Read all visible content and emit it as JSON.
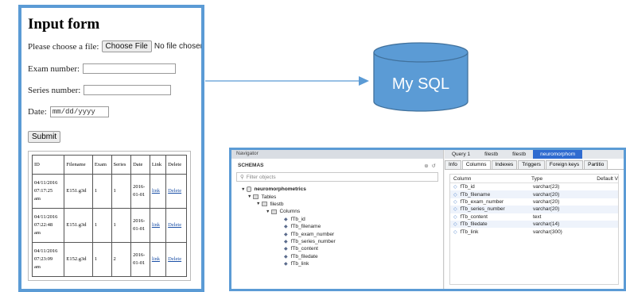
{
  "form": {
    "title": "Input form",
    "file_label": "Please choose a file:",
    "choose_file_button": "Choose File",
    "no_file_text": "No file chosen",
    "exam_label": "Exam number:",
    "series_label": "Series number:",
    "date_label": "Date:",
    "date_placeholder": "mm/dd/yyyy",
    "submit_button": "Submit",
    "table": {
      "headers": [
        "ID",
        "Filename",
        "Exam",
        "Series",
        "Date",
        "Link",
        "Delete"
      ],
      "rows": [
        {
          "id_date": "04/11/2016",
          "id_time": "07:17:25",
          "id_suffix": "am",
          "filename": "E151.g3d",
          "exam": "1",
          "series": "1",
          "date_year": "2016-",
          "date_md": "01-01",
          "link": "link",
          "delete": "Delete"
        },
        {
          "id_date": "04/11/2016",
          "id_time": "07:22:48",
          "id_suffix": "am",
          "filename": "E151.g3d",
          "exam": "1",
          "series": "1",
          "date_year": "2016-",
          "date_md": "01-01",
          "link": "link",
          "delete": "Delete"
        },
        {
          "id_date": "04/11/2016",
          "id_time": "07:23:09",
          "id_suffix": "am",
          "filename": "E152.g3d",
          "exam": "1",
          "series": "2",
          "date_year": "2016-",
          "date_md": "01-01",
          "link": "link",
          "delete": "Delete"
        }
      ]
    }
  },
  "database": {
    "label": "My SQL",
    "fill": "#5b9bd5",
    "stroke": "#41719c"
  },
  "arrow_color": "#5b9bd5",
  "workbench": {
    "navigator": "Navigator",
    "schemas": "SCHEMAS",
    "filter_placeholder": "Filter objects",
    "tree": {
      "db": "neuromorphometrics",
      "tables": "Tables",
      "table": "filestb",
      "columns": "Columns",
      "column_items": [
        "fTb_id",
        "fTb_filename",
        "fTb_exam_number",
        "fTb_series_number",
        "fTb_content",
        "fTb_filedate",
        "fTb_link"
      ]
    },
    "query_tabs": [
      "Query 1",
      "filestb",
      "filestb",
      "neuromorphom"
    ],
    "info_tabs": [
      "Info",
      "Columns",
      "Indexes",
      "Triggers",
      "Foreign keys",
      "Partitio"
    ],
    "grid_headers": [
      "Column",
      "Type",
      "Default V"
    ],
    "grid_rows": [
      {
        "name": "fTb_id",
        "type": "varchar(23)"
      },
      {
        "name": "fTb_filename",
        "type": "varchar(20)"
      },
      {
        "name": "fTb_exam_number",
        "type": "varchar(20)"
      },
      {
        "name": "fTb_series_number",
        "type": "varchar(20)"
      },
      {
        "name": "fTb_content",
        "type": "text"
      },
      {
        "name": "fTb_filedate",
        "type": "varchar(14)"
      },
      {
        "name": "fTb_link",
        "type": "varchar(300)"
      }
    ]
  }
}
